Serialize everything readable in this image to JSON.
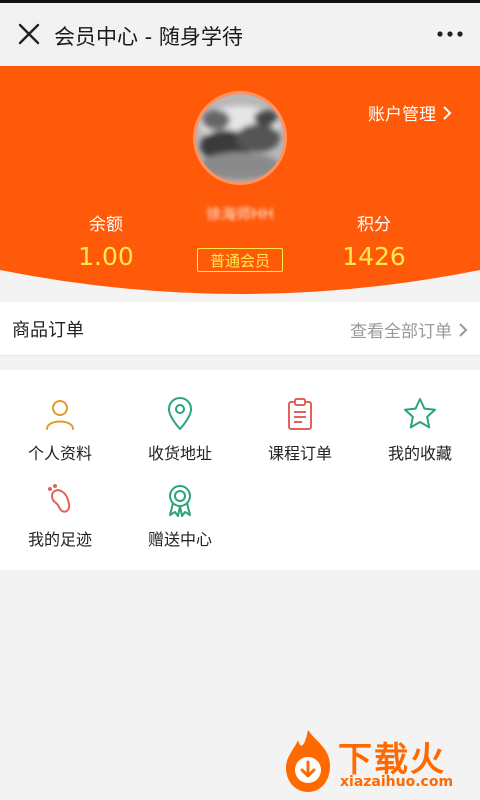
{
  "header": {
    "title": "会员中心 - 随身学待"
  },
  "profile": {
    "account_link": "账户管理",
    "username": "徐海师HH",
    "balance_label": "余额",
    "balance_value": "1.00",
    "membership_badge": "普通会员",
    "points_label": "积分",
    "points_value": "1426"
  },
  "orders": {
    "title": "商品订单",
    "view_all": "查看全部订单"
  },
  "menu": [
    {
      "label": "个人资料",
      "icon": "person-icon",
      "color": "#e39a2d"
    },
    {
      "label": "收货地址",
      "icon": "location-pin-icon",
      "color": "#2aa57a"
    },
    {
      "label": "课程订单",
      "icon": "clipboard-icon",
      "color": "#e0625a"
    },
    {
      "label": "我的收藏",
      "icon": "star-icon",
      "color": "#2aa57a"
    },
    {
      "label": "我的足迹",
      "icon": "footprint-icon",
      "color": "#e0625a"
    },
    {
      "label": "赠送中心",
      "icon": "award-ribbon-icon",
      "color": "#2aa57a"
    }
  ],
  "watermark": {
    "text": "下载火",
    "url": "xiazaihuo.com"
  },
  "colors": {
    "hero": "#ff5a0a",
    "accent_yellow": "#ffe94d"
  }
}
